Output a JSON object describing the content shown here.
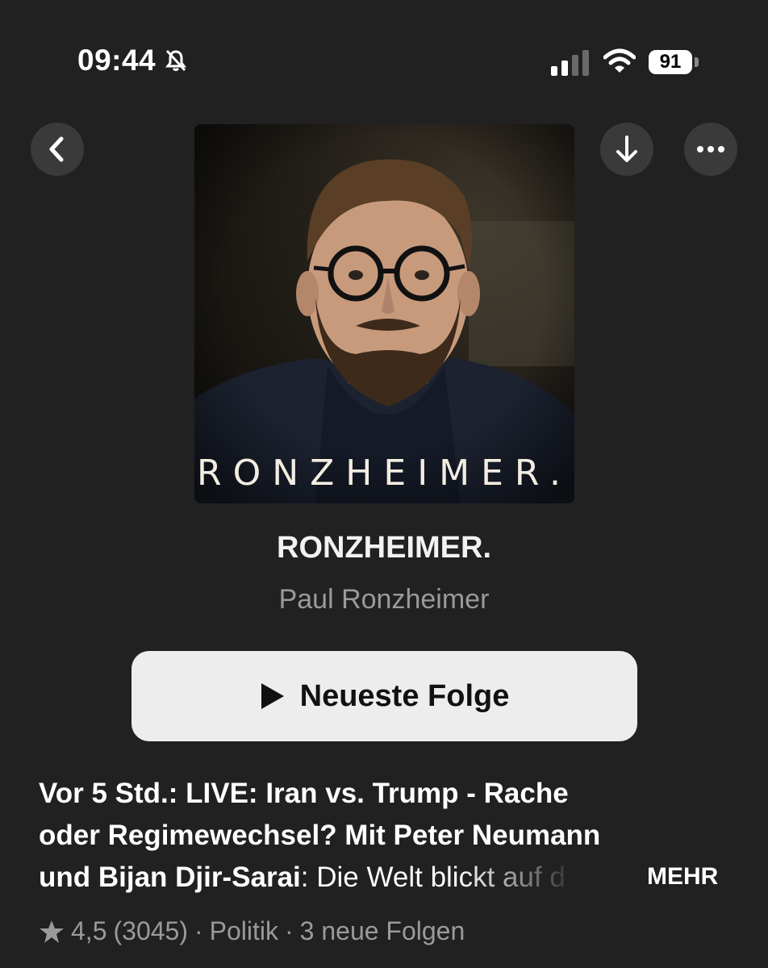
{
  "status_bar": {
    "time": "09:44",
    "battery": "91",
    "icons": [
      "bell-slash-icon",
      "signal-icon",
      "wifi-icon",
      "battery-icon"
    ]
  },
  "nav": {
    "icons": [
      "chevron-left-icon",
      "download-arrow-icon",
      "ellipsis-icon"
    ]
  },
  "artwork": {
    "text": "RONZHEIMER."
  },
  "podcast": {
    "title": "RONZHEIMER.",
    "author": "Paul Ronzheimer"
  },
  "play_button": {
    "label": "Neueste Folge",
    "icon": "play-icon"
  },
  "description": {
    "line1": "Vor 5 Std.: LIVE: Iran vs. Trump - Rache",
    "line2": "oder Regimewechsel? Mit Peter Neumann",
    "line3_bold": "und Bijan Djir-Sarai",
    "line3_rest": ": Die Welt blickt auf d",
    "more_label": "MEHR"
  },
  "meta": {
    "rating": "4,5",
    "count": "(3045)",
    "separator": "·",
    "category": "Politik",
    "new_episodes": "3 neue Folgen"
  },
  "colors": {
    "background": "#212121",
    "button_bg": "#ededed",
    "secondary_text": "#9a9a9a",
    "round_button_bg": "#3a3a3a"
  }
}
